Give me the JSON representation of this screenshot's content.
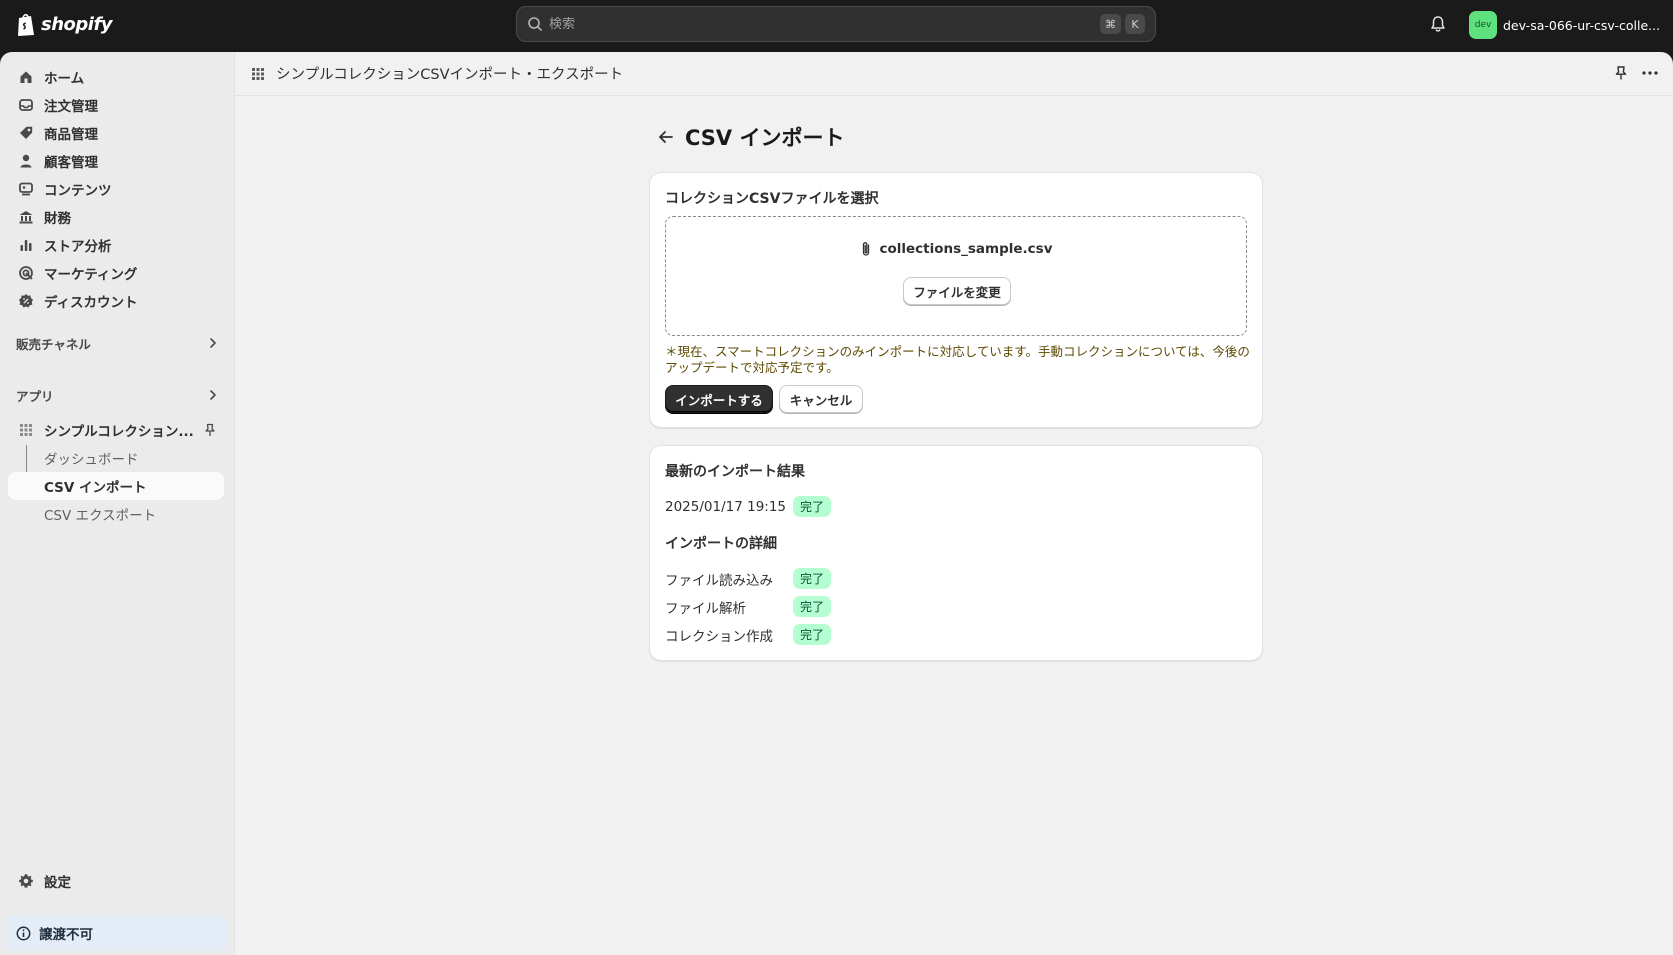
{
  "topbar": {
    "logo_text": "shopify",
    "search_placeholder": "検索",
    "kbd_cmd": "⌘",
    "kbd_k": "K",
    "store_avatar": "dev",
    "store_name": "dev-sa-066-ur-csv-colle..."
  },
  "sidebar": {
    "nav": [
      {
        "label": "ホーム",
        "icon": "home-icon"
      },
      {
        "label": "注文管理",
        "icon": "inbox-icon"
      },
      {
        "label": "商品管理",
        "icon": "tag-icon"
      },
      {
        "label": "顧客管理",
        "icon": "person-icon"
      },
      {
        "label": "コンテンツ",
        "icon": "content-icon"
      },
      {
        "label": "財務",
        "icon": "bank-icon"
      },
      {
        "label": "ストア分析",
        "icon": "bar-chart-icon"
      },
      {
        "label": "マーケティング",
        "icon": "target-icon"
      },
      {
        "label": "ディスカウント",
        "icon": "discount-icon"
      }
    ],
    "sales_channels_label": "販売チャネル",
    "apps_label": "アプリ",
    "app_name": "シンプルコレクション...",
    "app_subitems": [
      "ダッシュボード",
      "CSV インポート",
      "CSV エクスポート"
    ],
    "settings_label": "設定",
    "notice_label": "譲渡不可"
  },
  "main": {
    "appbar_title": "シンプルコレクションCSVインポート・エクスポート",
    "page_title": "CSV インポート",
    "select_card": {
      "title": "コレクションCSVファイルを選択",
      "file_name": "collections_sample.csv",
      "change_button": "ファイルを変更",
      "note": "＊現在、スマートコレクションのみインポートに対応しています。手動コレクションについては、今後のアップデートで対応予定です。",
      "import_button": "インポートする",
      "cancel_button": "キャンセル"
    },
    "result_card": {
      "title": "最新のインポート結果",
      "timestamp": "2025/01/17 19:15",
      "status": "完了",
      "details_title": "インポートの詳細",
      "details": [
        {
          "label": "ファイル読み込み",
          "status": "完了"
        },
        {
          "label": "ファイル解析",
          "status": "完了"
        },
        {
          "label": "コレクション作成",
          "status": "完了"
        }
      ]
    }
  },
  "colors": {
    "topbar_bg": "#1a1a1a",
    "badge_success_bg": "#b4fed2",
    "badge_success_text": "#0c5132",
    "primary_button": "#303030",
    "notice_bg": "#e3ecf7"
  }
}
